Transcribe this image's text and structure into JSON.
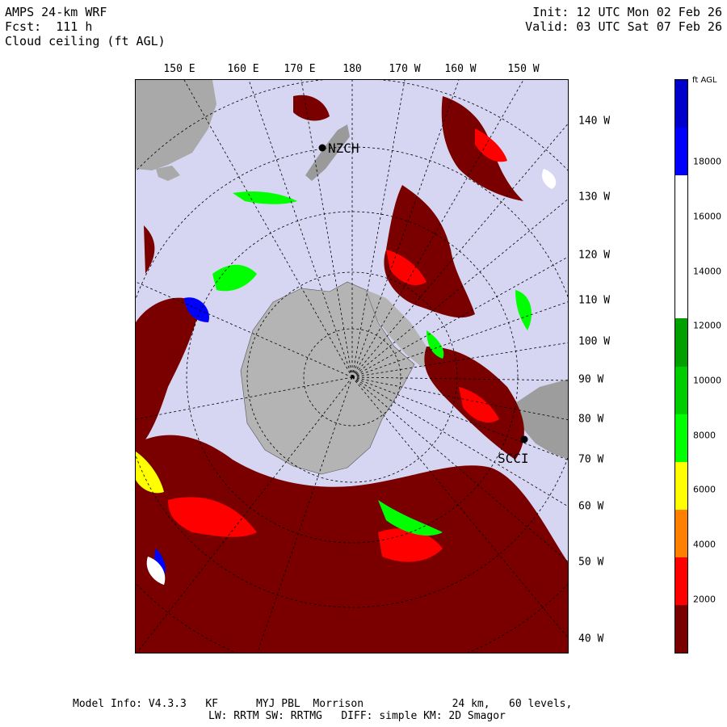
{
  "header": {
    "line1": "AMPS 24-km WRF",
    "line2": "Fcst:  111 h",
    "line3": "Cloud ceiling (ft AGL)",
    "init": "Init: 12 UTC Mon 02 Feb 26",
    "valid": "Valid: 03 UTC Sat 07 Feb 26"
  },
  "lon_top_labels": [
    "150 E",
    "160 E",
    "170 E",
    "180",
    "170 W",
    "160 W",
    "150 W"
  ],
  "lon_right_labels": [
    "140 W",
    "130 W",
    "120 W",
    "110 W",
    "100 W",
    "90 W",
    "80 W",
    "70 W",
    "60 W",
    "50 W",
    "40 W"
  ],
  "stations": [
    {
      "name": "NZCH"
    },
    {
      "name": "SCCI"
    }
  ],
  "colorbar": {
    "unit": "ft AGL",
    "tick_labels": [
      "18000",
      "16000",
      "14000",
      "12000",
      "10000",
      "8000",
      "6000",
      "4000",
      "2000"
    ],
    "levels": [
      {
        "color": "#7a0000"
      },
      {
        "color": "#ff0000"
      },
      {
        "color": "#ff7f00"
      },
      {
        "color": "#ffff00"
      },
      {
        "color": "#00ff00"
      },
      {
        "color": "#00cd00"
      },
      {
        "color": "#00a000"
      },
      {
        "color": "#ffffff"
      },
      {
        "color": "#ffffff"
      },
      {
        "color": "#ffffff"
      },
      {
        "color": "#0000ff"
      },
      {
        "color": "#0000cd"
      }
    ]
  },
  "footer": {
    "line1": "Model Info: V4.3.3   KF      MYJ PBL  Morrison              24 km,   60 levels,",
    "line2": "LW: RRTM SW: RRTMG   DIFF: simple KM: 2D Smagor"
  },
  "colors": {
    "background": "#d6d6f2",
    "land": "#a6a6a6",
    "dark_red": "#7a0000",
    "red": "#ff0000",
    "orange": "#ff7f00",
    "yellow": "#ffff00",
    "green": "#00ff00",
    "blue": "#0000ff",
    "white": "#ffffff"
  }
}
